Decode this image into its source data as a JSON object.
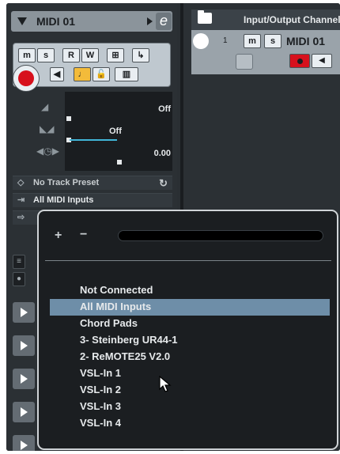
{
  "inspector": {
    "track_name": "MIDI 01",
    "edit_button_label": "e",
    "buttons": {
      "mute": "m",
      "solo": "s",
      "read": "R",
      "write": "W"
    },
    "params": [
      {
        "value": "Off",
        "icon": "volume-ramp-icon"
      },
      {
        "value": "Off",
        "icon": "pan-icon"
      },
      {
        "value": "0.00",
        "icon": "delay-icon"
      }
    ],
    "track_preset": "No Track Preset",
    "input_routing": "All MIDI Inputs"
  },
  "track_list": {
    "header_title": "Input/Output Channels",
    "track_number": "1",
    "track_name": "MIDI 01",
    "mute": "m",
    "solo": "s"
  },
  "popup": {
    "add_label": "+",
    "remove_label": "−",
    "search_value": "",
    "items": [
      {
        "label": "Not Connected",
        "selected": false
      },
      {
        "label": "All MIDI Inputs",
        "selected": true
      },
      {
        "label": "Chord Pads",
        "selected": false
      },
      {
        "label": "3- Steinberg UR44-1",
        "selected": false
      },
      {
        "label": "2- ReMOTE25 V2.0",
        "selected": false
      },
      {
        "label": "VSL-In 1",
        "selected": false
      },
      {
        "label": "VSL-In 2",
        "selected": false
      },
      {
        "label": "VSL-In 3",
        "selected": false
      },
      {
        "label": "VSL-In 4",
        "selected": false
      }
    ]
  },
  "colors": {
    "accent_selected": "#6e8ea8",
    "record_red": "#d7101c",
    "panel_dark": "#2b3034"
  }
}
